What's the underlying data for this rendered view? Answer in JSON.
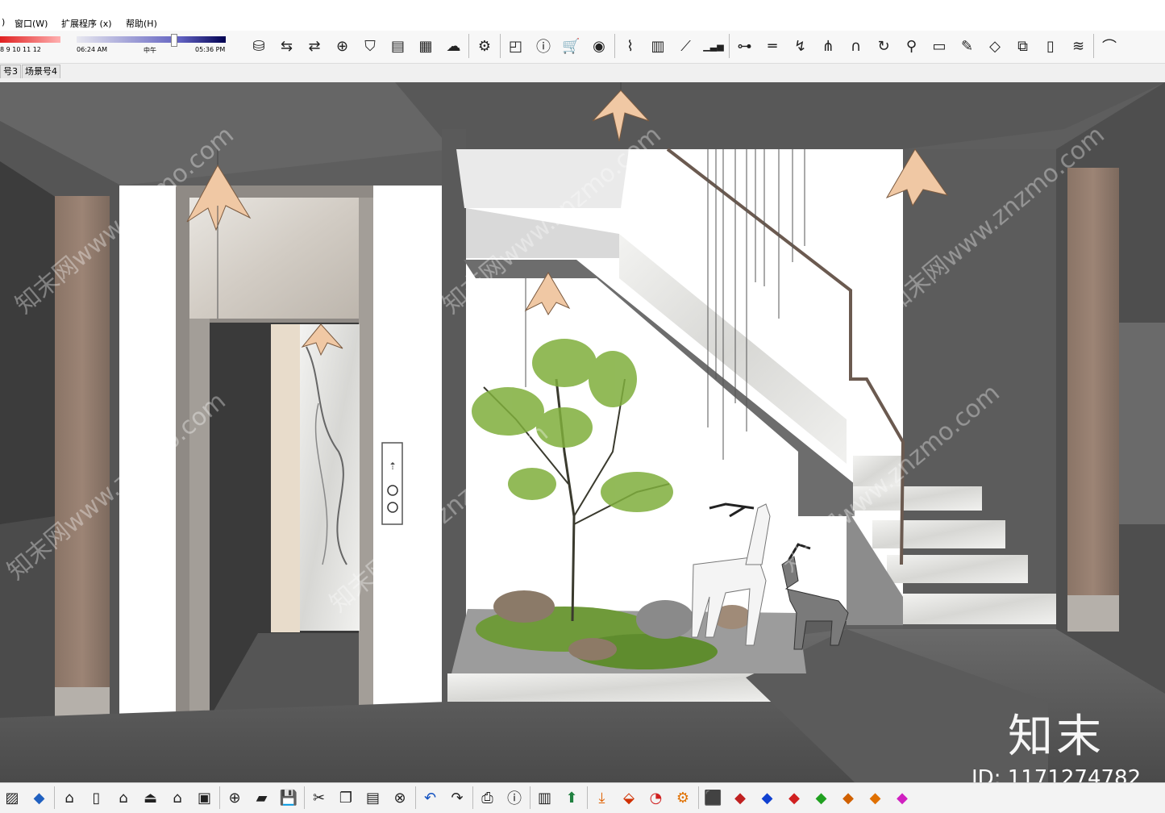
{
  "menus": [
    {
      "id": "paren",
      "label": ")"
    },
    {
      "id": "window",
      "label": "窗口(W)"
    },
    {
      "id": "extensions",
      "label": "扩展程序 (x)"
    },
    {
      "id": "help",
      "label": "帮助(H)"
    }
  ],
  "shadow_panel": {
    "month_ticks": "8  9  10  11  12",
    "time_start": "06:24 AM",
    "time_mid": "中午",
    "time_end": "05:36 PM"
  },
  "scene_tabs": [
    {
      "label": "号3"
    },
    {
      "label": "场景号4"
    }
  ],
  "toolbar_icons": [
    "warehouse-icon",
    "swap-icon",
    "component-swap-icon",
    "add-circle-icon",
    "shield-icon",
    "chart-icon",
    "checker-icon",
    "cloud-upload-icon",
    "settings-gear-icon",
    "comment-icon",
    "info-icon",
    "cart-icon",
    "user-icon",
    "stair-icon",
    "column-icon",
    "beam-icon",
    "bar-chart-icon",
    "align-icon",
    "line-tool-icon",
    "curve-tool-icon",
    "tree-tool-icon",
    "arch-tool-icon",
    "arc-tool-icon",
    "node-tool-icon",
    "slab-tool-icon",
    "edit-tool-icon",
    "stack-tool-icon",
    "cube-tool-icon",
    "book-tool-icon",
    "layers-tool-icon",
    "tunnel-tool-icon"
  ],
  "bottom_icons": [
    "layer-paint-icon",
    "cube-face-icon",
    "house-side-icon",
    "door-icon",
    "home-icon",
    "roof-icon",
    "house-outline-icon",
    "house-box-icon",
    "zoom-add-icon",
    "open-folder-icon",
    "save-icon",
    "cut-icon",
    "copy-icon",
    "paste-icon",
    "delete-icon",
    "undo-icon",
    "redo-icon",
    "print-icon",
    "info-icon",
    "color-palette-icon",
    "arrow-up-icon",
    "download-icon",
    "layers-red-icon",
    "paint-icon",
    "gear-colored-icon",
    "box-red-icon",
    "axis-e-icon",
    "axis-j-icon",
    "axis-r-icon",
    "axis-v-icon",
    "axis-n-icon",
    "axis-x-icon",
    "axis-d-icon"
  ],
  "watermark": {
    "text": "知末网www.znzmo.com",
    "logo": "知末",
    "id": "ID: 1171274782"
  }
}
